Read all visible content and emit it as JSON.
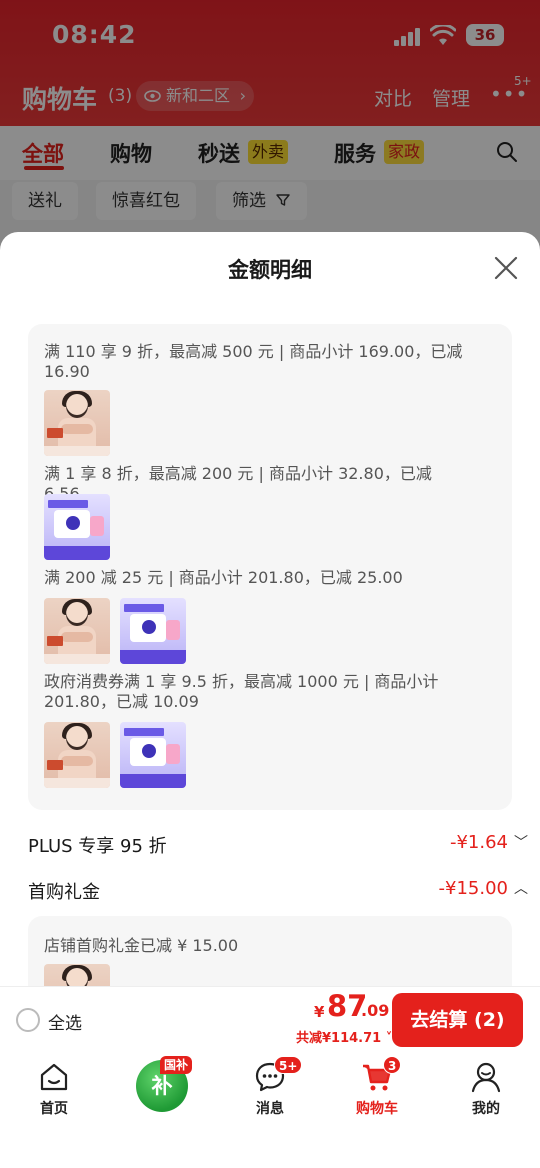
{
  "status": {
    "time": "08:42",
    "battery": "36"
  },
  "header": {
    "title": "购物车",
    "count": "(3)",
    "location": "新和二区",
    "compare": "对比",
    "manage": "管理",
    "more_badge": "5+"
  },
  "tabs": {
    "all": "全部",
    "shopping": "购物",
    "fast": "秒送",
    "fast_tag": "外卖",
    "service": "服务",
    "service_tag": "家政"
  },
  "filters": {
    "gift": "送礼",
    "hongbao": "惊喜红包",
    "filter": "筛选"
  },
  "sheet": {
    "title": "金额明细",
    "promo_lines": [
      "满 110 享 9 折，最高减 500 元 | 商品小计 169.00，已减 16.90",
      "满 1 享 8 折，最高减 200 元 | 商品小计 32.80，已减 6.56",
      "满 200 减 25 元 | 商品小计 201.80，已减 25.00",
      "政府消费券满 1 享 9.5 折，最高减 1000 元 | 商品小计 201.80，已减 10.09"
    ],
    "plus_label": "PLUS 专享 95 折",
    "plus_value": "-¥1.64",
    "first_label": "首购礼金",
    "first_value": "-¥15.00",
    "gift_text": "店铺首购礼金已减 ¥ 15.00"
  },
  "checkout": {
    "select_all": "全选",
    "yen": "¥",
    "price_int": "87",
    "price_dec": ".09",
    "saved": "共减¥114.71",
    "button": "去结算 (2)"
  },
  "nav": {
    "home": "首页",
    "subsidy_tag": "国补",
    "subsidy_char": "补",
    "message": "消息",
    "message_badge": "5+",
    "cart": "购物车",
    "cart_badge": "3",
    "mine": "我的"
  },
  "colors": {
    "accent": "#e4211c",
    "header_red": "#e8242c"
  }
}
